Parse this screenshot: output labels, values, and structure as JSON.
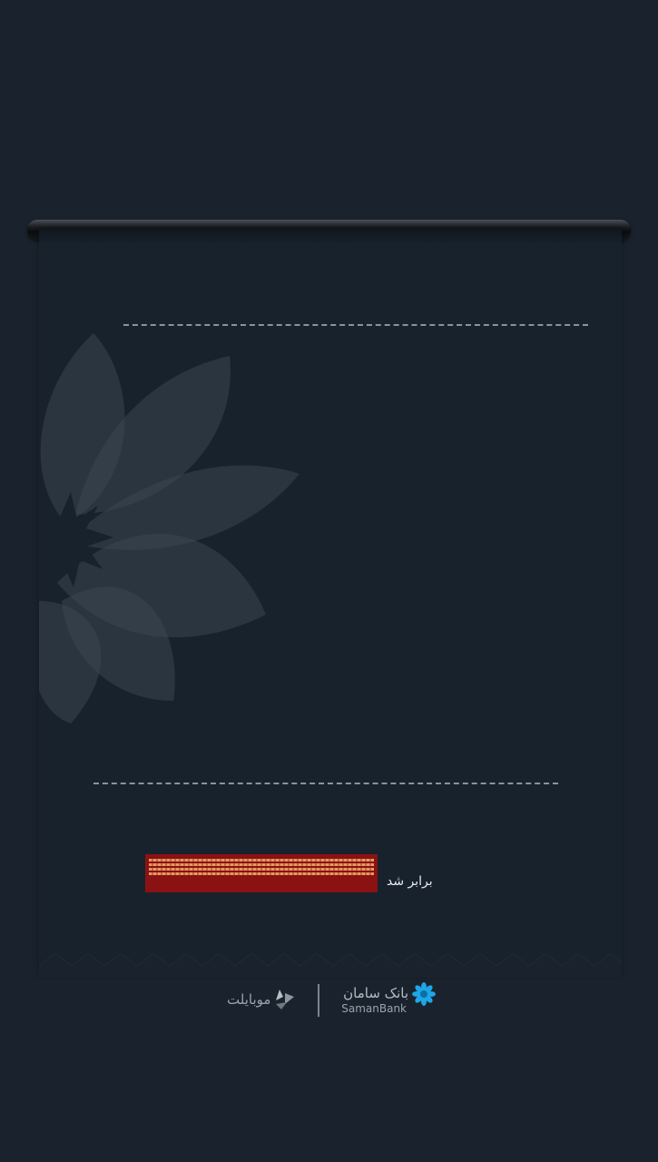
{
  "receipt": {
    "amount_suffix": "برابر شد"
  },
  "footer": {
    "mobilet_label": "موبایلت",
    "bank_name_fa": "بانک سامان",
    "bank_name_en": "SamanBank"
  },
  "colors": {
    "background": "#1a232d",
    "receipt": "#18222d",
    "redaction": "#8a1212",
    "bank_brand": "#1ea6e6"
  },
  "icons": {
    "watermark": "saman-flower-watermark",
    "mobilet": "mobilet-logo-icon",
    "bank": "saman-flower-icon"
  }
}
